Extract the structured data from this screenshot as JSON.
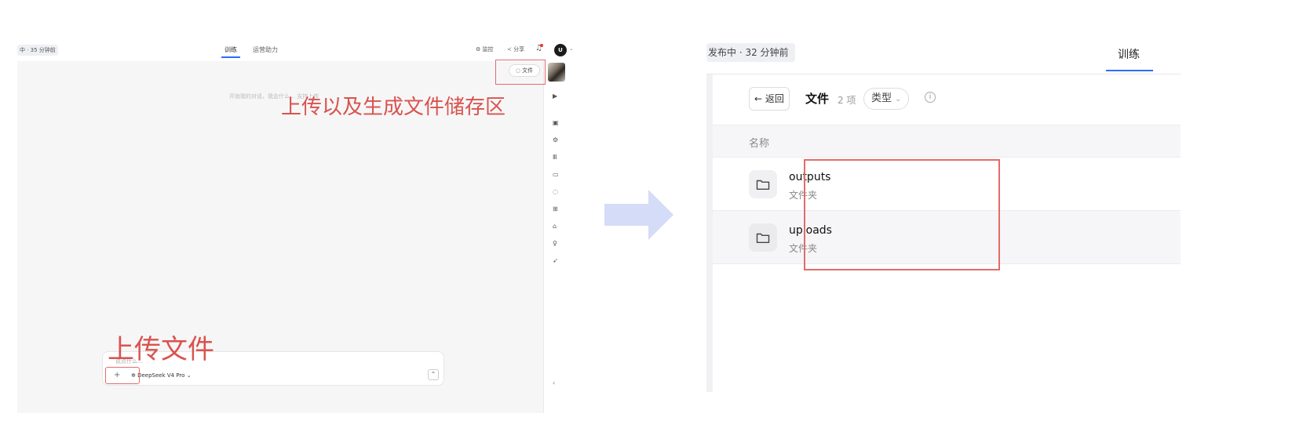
{
  "left": {
    "status": "中 · 35 分钟前",
    "tabs": [
      "训练",
      "运营助力"
    ],
    "tools": {
      "monitor": "监控",
      "share": "分享"
    },
    "avatar": "U",
    "file_button": "文件",
    "hint": "开始我的对话，我会什么…  支持上传",
    "annotation_storage": "上传以及生成文件储存区",
    "annotation_upload": "上传文件",
    "input_placeholder": "说点什么...",
    "model": "DeepSeek V4 Pro"
  },
  "right": {
    "status": "发布中 · 32 分钟前",
    "tab": "训练",
    "back": "← 返回",
    "title": "文件",
    "count": "2 项",
    "type_filter": "类型",
    "column_name": "名称",
    "rows": [
      {
        "name": "outputs",
        "type": "文件夹"
      },
      {
        "name": "uploads",
        "type": "文件夹"
      }
    ]
  },
  "colors": {
    "accent": "#2f6bff",
    "annotation": "#d9534f",
    "arrow": "#d5dcf7"
  },
  "icons": [
    "folder-icon",
    "arrow-right-icon",
    "info-icon",
    "chevron-down-icon",
    "plus-icon",
    "send-icon",
    "bell-icon",
    "share-icon",
    "gear-icon"
  ]
}
